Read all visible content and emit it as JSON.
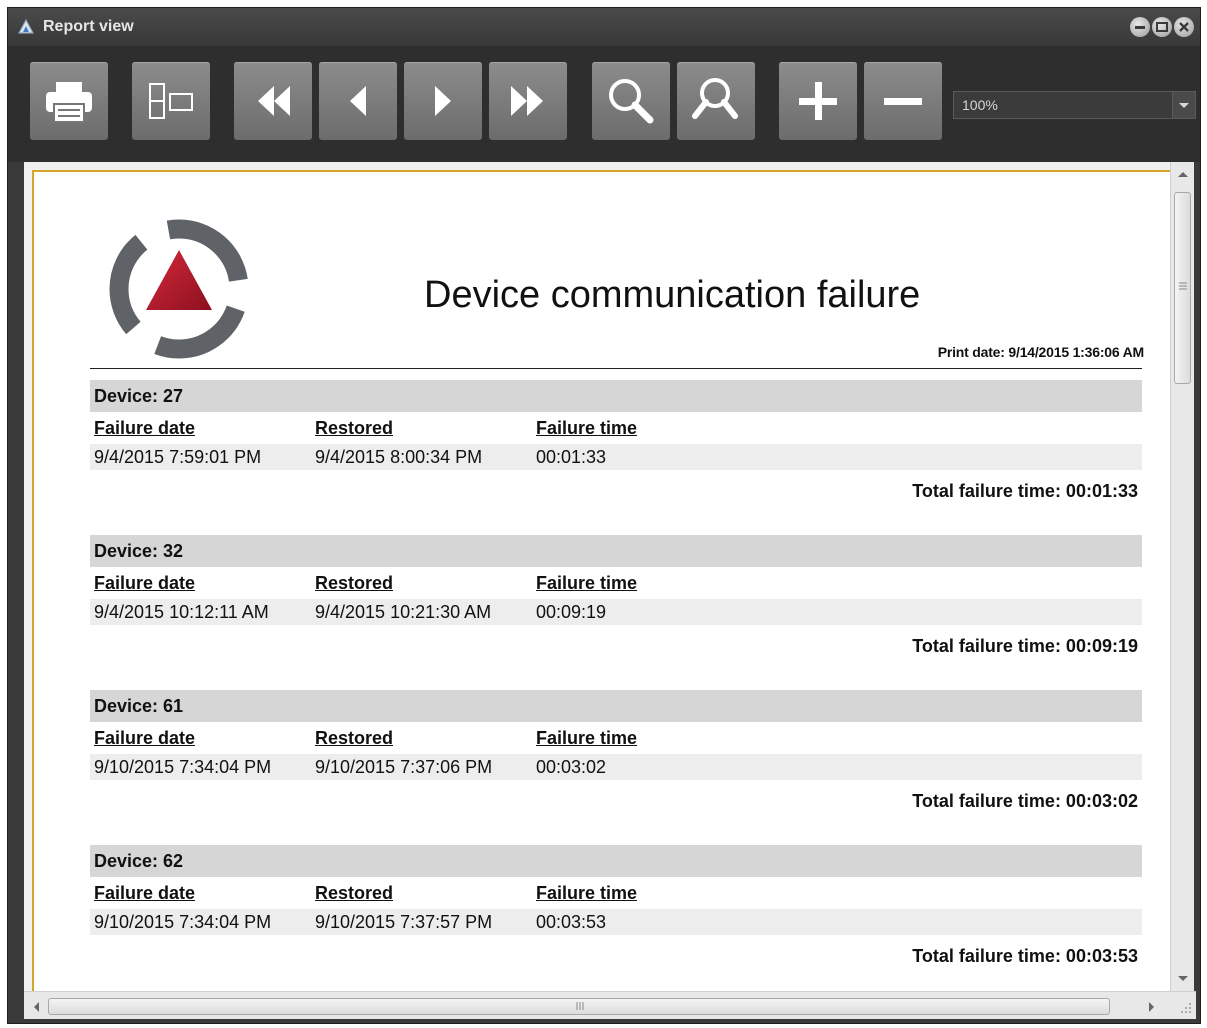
{
  "window": {
    "title": "Report view"
  },
  "toolbar": {
    "zoom_value": "100%"
  },
  "report": {
    "title": "Device communication failure",
    "print_date": "Print date: 9/14/2015 1:36:06 AM",
    "columns": [
      "Failure date",
      "Restored",
      "Failure time"
    ],
    "devices": [
      {
        "label": "Device: 27",
        "failure_date": "9/4/2015 7:59:01 PM",
        "restored": "9/4/2015 8:00:34 PM",
        "failure_time": "00:01:33",
        "total": "Total failure time: 00:01:33"
      },
      {
        "label": "Device: 32",
        "failure_date": "9/4/2015 10:12:11 AM",
        "restored": "9/4/2015 10:21:30 AM",
        "failure_time": "00:09:19",
        "total": "Total failure time: 00:09:19"
      },
      {
        "label": "Device: 61",
        "failure_date": "9/10/2015 7:34:04 PM",
        "restored": "9/10/2015 7:37:06 PM",
        "failure_time": "00:03:02",
        "total": "Total failure time: 00:03:02"
      },
      {
        "label": "Device: 62",
        "failure_date": "9/10/2015 7:34:04 PM",
        "restored": "9/10/2015 7:37:57 PM",
        "failure_time": "00:03:53",
        "total": "Total failure time: 00:03:53"
      }
    ]
  },
  "colors": {
    "accent_red": "#b01c2e",
    "logo_gray": "#5f6368",
    "page_border": "#d4a62a"
  },
  "icons": [
    "print-icon",
    "page-setup-icon",
    "first-page-icon",
    "previous-page-icon",
    "next-page-icon",
    "last-page-icon",
    "zoom-icon",
    "zoom-fit-icon",
    "zoom-in-icon",
    "zoom-out-icon"
  ]
}
